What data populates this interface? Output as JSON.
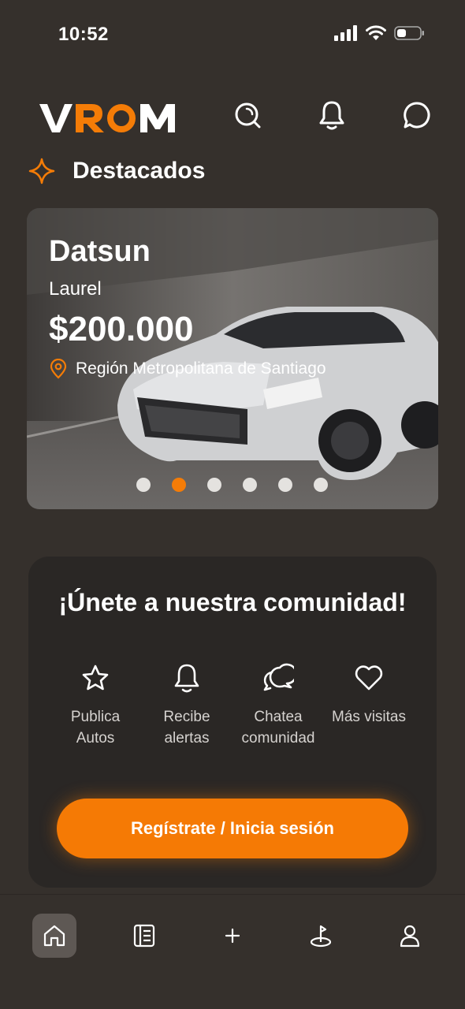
{
  "status_bar": {
    "time": "10:52"
  },
  "header": {
    "logo_text_v": "V",
    "logo_text_ro": "RO",
    "logo_text_m": "M"
  },
  "featured": {
    "section_title": "Destacados",
    "car": {
      "make": "Datsun",
      "model": "Laurel",
      "price": "$200.000",
      "location": "Región Metropolitana de Santiago"
    },
    "slides_total": 6,
    "active_slide": 2
  },
  "community": {
    "title": "¡Únete a nuestra comunidad!",
    "features": [
      {
        "icon": "star-icon",
        "label": "Publica Autos"
      },
      {
        "icon": "bell-icon",
        "label": "Recibe alertas"
      },
      {
        "icon": "chat-bubbles-icon",
        "label": "Chatea comunidad"
      },
      {
        "icon": "heart-icon",
        "label": "Más visitas"
      }
    ],
    "cta_label": "Regístrate / Inicia sesión"
  },
  "colors": {
    "accent": "#f47c07",
    "background": "#35302c",
    "card": "#2a2725"
  },
  "bottom_nav": {
    "items": [
      {
        "icon": "home-icon",
        "active": true
      },
      {
        "icon": "catalog-icon",
        "active": false
      },
      {
        "icon": "plus-icon",
        "active": false
      },
      {
        "icon": "steering-icon",
        "active": false
      },
      {
        "icon": "user-icon",
        "active": false
      }
    ]
  }
}
